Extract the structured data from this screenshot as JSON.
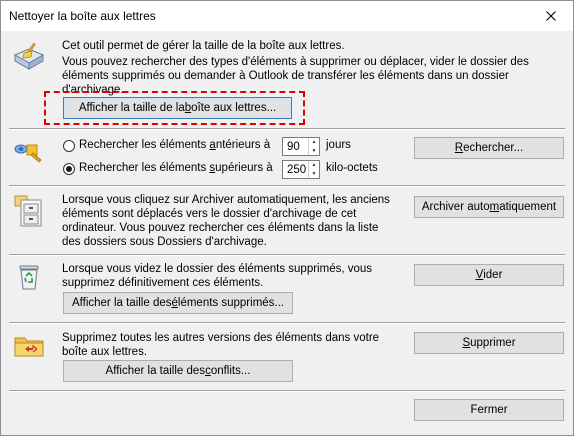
{
  "window": {
    "title": "Nettoyer la boîte aux lettres"
  },
  "section1": {
    "line1": "Cet outil permet de gérer la taille de la boîte aux lettres.",
    "line2": "Vous pouvez rechercher des types d'éléments à supprimer ou déplacer, vider le dossier des",
    "line3": "éléments supprimés ou demander à Outlook de transférer les éléments dans un dossier",
    "line4": "d'archivage.",
    "view_size_button": {
      "pre": "Afficher la taille de la ",
      "key": "b",
      "post": "oîte aux lettres..."
    }
  },
  "section2": {
    "older": {
      "pre": "Rechercher les éléments ",
      "key": "a",
      "post": "ntérieurs à",
      "value": "90",
      "unit": "jours"
    },
    "larger": {
      "pre": "Rechercher les éléments ",
      "key": "s",
      "post": "upérieurs à",
      "value": "250",
      "unit": "kilo-octets"
    },
    "search_button": {
      "key": "R",
      "post": "echercher..."
    },
    "selected": "larger"
  },
  "section3": {
    "line1": "Lorsque vous cliquez sur Archiver automatiquement, les anciens",
    "line2": "éléments sont déplacés vers le dossier d'archivage de cet",
    "line3": "ordinateur. Vous pouvez rechercher ces éléments dans la liste",
    "line4": "des dossiers sous Dossiers d'archivage.",
    "archive_button": {
      "pre": "Archiver auto",
      "key": "m",
      "post": "atiquement"
    }
  },
  "section4": {
    "line1": "Lorsque vous videz le dossier des éléments supprimés, vous",
    "line2": "supprimez définitivement ces éléments.",
    "empty_button": {
      "key": "V",
      "post": "ider"
    },
    "view_deleted_button": {
      "pre": "Afficher la taille des ",
      "key": "é",
      "post": "léments supprimés..."
    }
  },
  "section5": {
    "line1": "Supprimez toutes les autres versions des éléments dans votre",
    "line2": "boîte aux lettres.",
    "delete_button": {
      "key": "S",
      "post": "upprimer"
    },
    "view_conflicts_button": {
      "pre": "Afficher la taille des ",
      "key": "c",
      "post": "onflits..."
    }
  },
  "close_button": {
    "label": "Fermer"
  }
}
